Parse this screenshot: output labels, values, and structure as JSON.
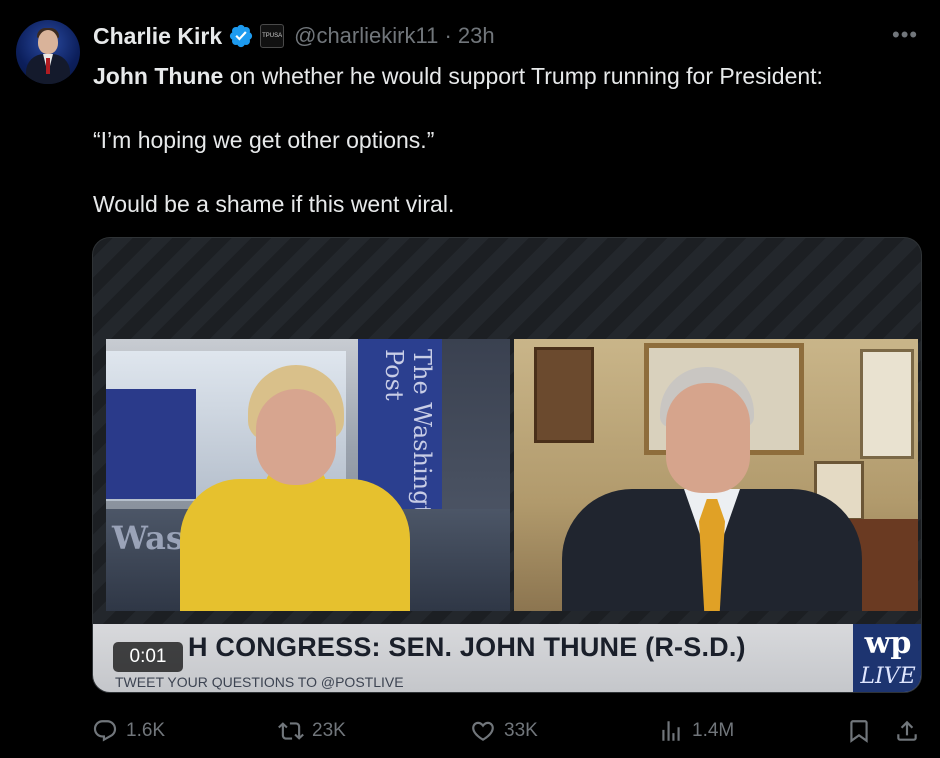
{
  "author": {
    "name": "Charlie Kirk",
    "handle": "@charliekirk11",
    "separator": "·",
    "time": "23h",
    "affiliation_badge": "TPUSA"
  },
  "tweet": {
    "bold_name": "John Thune",
    "line1_rest": " on whether he would support Trump running for President:",
    "line2": "“I’m hoping we get other options.”",
    "line3": "Would be a shame if this went viral."
  },
  "video": {
    "timestamp": "0:01",
    "headline": "H CONGRESS: SEN. JOHN THUNE (R-S.D.)",
    "subline": "TWEET YOUR QUESTIONS TO @POSTLIVE",
    "banner_text": "The Washington Post",
    "wall_text": "Was",
    "brand_logo": "wp",
    "brand_live": "LIVE"
  },
  "actions": {
    "replies": "1.6K",
    "reposts": "23K",
    "likes": "33K",
    "views": "1.4M"
  },
  "icons": {
    "reply": "reply-icon",
    "repost": "repost-icon",
    "like": "heart-icon",
    "views": "views-icon",
    "bookmark": "bookmark-icon",
    "share": "share-icon",
    "verified": "verified-badge-icon",
    "more": "more-icon"
  },
  "colors": {
    "background": "#000000",
    "text": "#e7e9ea",
    "muted": "#71767b",
    "verified": "#1d9bf0",
    "wp_blue": "#1d3470"
  }
}
